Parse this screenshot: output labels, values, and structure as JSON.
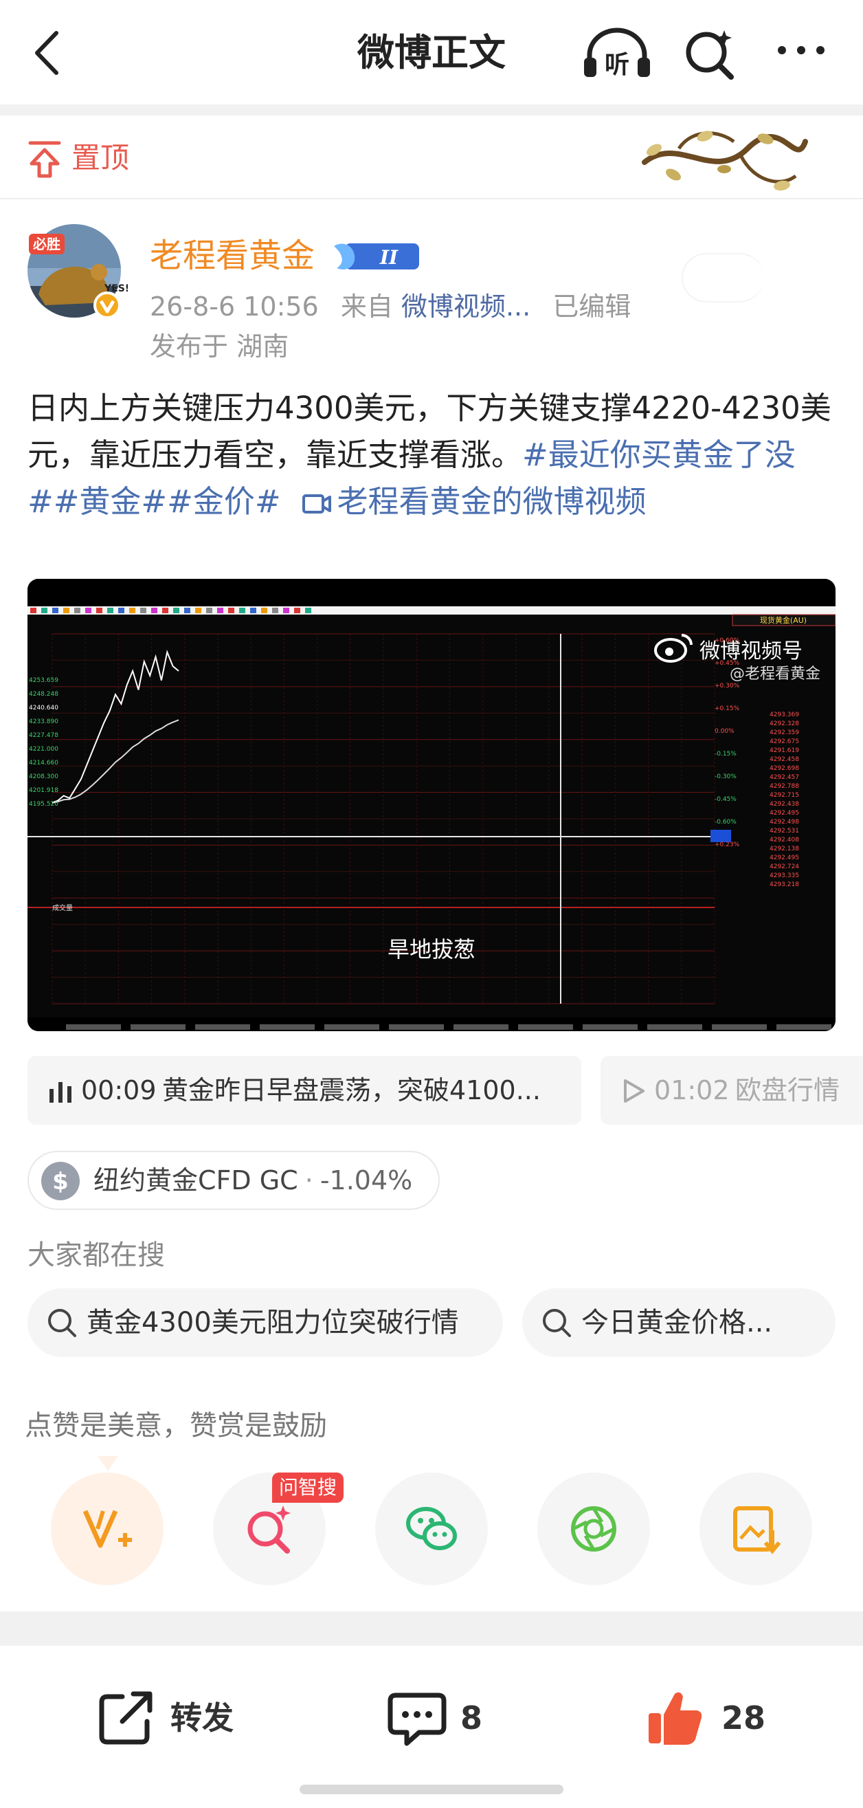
{
  "nav": {
    "title": "微博正文",
    "listen_label": "听"
  },
  "pinned": {
    "label": "置顶"
  },
  "author": {
    "name": "老程看黄金",
    "level": "II",
    "avatar_text": "必胜",
    "avatar_sub": "YES!",
    "time": "26-8-6 10:56",
    "source_prefix": "来自",
    "source": "微博视频...",
    "edited": "已编辑",
    "location": "发布于 湖南"
  },
  "post": {
    "text": "日内上方关键压力4300美元，下方关键支撑4220-4230美元，靠近压力看空，靠近支撑看涨。",
    "tags": "#最近你买黄金了没##黄金##金价#",
    "video_link": "老程看黄金的微博视频"
  },
  "video": {
    "watermark": "微博视频号",
    "watermark_sub": "@老程看黄金",
    "subtitle": "旱地拔葱"
  },
  "chapters": [
    {
      "time": "00:09",
      "title": "黄金昨日早盘震荡，突破4100..."
    },
    {
      "time": "01:02",
      "title": "欧盘行情"
    }
  ],
  "stock": {
    "icon": "$",
    "name": "纽约黄金CFD GC",
    "separator": "·",
    "change": "-1.04%"
  },
  "search": {
    "heading": "大家都在搜",
    "items": [
      "黄金4300美元阻力位突破行情",
      "今日黄金价格..."
    ]
  },
  "praise": {
    "heading": "点赞是美意，赞赏是鼓励",
    "ask_badge": "问智搜"
  },
  "actions": {
    "repost": "转发",
    "comments": "8",
    "likes": "28"
  },
  "colors": {
    "accent": "#f08a24",
    "link": "#4a6fb0",
    "pin": "#e85a4f",
    "like": "#f05a3a"
  },
  "chart_data": {
    "type": "line",
    "title": "",
    "price_ticks": [
      "4253.659",
      "4248.248",
      "4240.640",
      "4233.890",
      "4227.478",
      "4221.000",
      "4214.660",
      "4208.300",
      "4201.918",
      "4195.520"
    ],
    "pct_ticks": [
      "+0.60%",
      "+0.45%",
      "+0.30%",
      "+0.15%",
      "0.00%",
      "-0.15%",
      "-0.30%",
      "-0.45%",
      "-0.60%",
      "+0.23%"
    ],
    "volume_label": "成交量",
    "x": [
      0,
      1,
      2,
      3,
      4,
      5,
      6,
      7,
      8,
      9,
      10,
      11,
      12,
      13,
      14,
      15,
      16,
      17,
      18,
      19,
      20,
      21,
      22
    ],
    "y": [
      4240,
      4241,
      4243,
      4242,
      4246,
      4250,
      4256,
      4262,
      4268,
      4274,
      4279,
      4286,
      4282,
      4290,
      4296,
      4288,
      4300,
      4294,
      4302,
      4292,
      4304,
      4298,
      4296
    ],
    "ylim": [
      4195,
      4310
    ],
    "right_panel_title": "现货黄金(AU)",
    "quote_values": [
      "4293.369",
      "4292.328",
      "4292.359",
      "4292.675",
      "4291.619",
      "4292.458",
      "4292.698",
      "4292.457",
      "4292.788",
      "4292.715",
      "4292.438",
      "4292.495",
      "4292.498",
      "4292.531",
      "4292.408",
      "4292.138",
      "4292.495",
      "4292.724",
      "4293.335",
      "4293.218"
    ]
  }
}
